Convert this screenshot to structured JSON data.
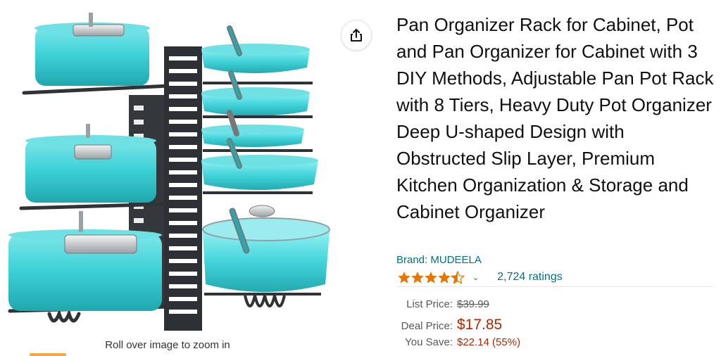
{
  "product": {
    "title": "Pan Organizer Rack for Cabinet, Pot and Pan Organizer for Cabinet with 3 DIY Methods, Adjustable Pan Pot Rack with 8 Tiers, Heavy Duty Pot Organizer Deep U-shaped Design with Obstructed Slip Layer, Premium Kitchen Organization & Storage and Cabinet Organizer",
    "brand": "Brand: MUDEELA",
    "rating_stars": 4.5,
    "ratings_count": "2,724 ratings"
  },
  "gallery": {
    "zoom_hint": "Roll over image to zoom in",
    "share_icon": "share-icon"
  },
  "pricing": {
    "list_label": "List Price:",
    "list_price": "$39.99",
    "deal_label": "Deal Price:",
    "deal_price": "$17.85",
    "save_label": "You Save:",
    "save_amount": "$22.14 (55%)"
  },
  "colors": {
    "pot": "#3fd3d8",
    "rack": "#2f3236",
    "star": "#e77600",
    "link": "#007185",
    "price": "#B12704"
  }
}
